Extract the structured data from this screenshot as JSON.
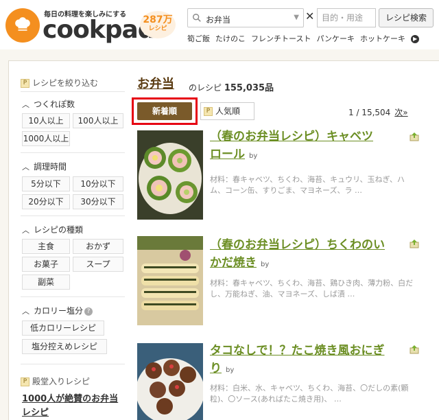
{
  "header": {
    "tagline": "毎日の料理を楽しみにする",
    "logo": "cookpad",
    "count_num": "287万",
    "count_unit": "レシピ",
    "search_value": "お弁当",
    "purpose_placeholder": "目的・用途",
    "search_button": "レシピ検索",
    "keywords": [
      "筍ご飯",
      "たけのこ",
      "フレンチトースト",
      "パンケーキ",
      "ホットケーキ"
    ]
  },
  "sidebar": {
    "filter_title": "レシピを絞り込む",
    "servings": {
      "title": "つくれぽ数",
      "chips": [
        "10人以上",
        "100人以上",
        "1000人以上"
      ]
    },
    "time": {
      "title": "調理時間",
      "chips": [
        "5分以下",
        "10分以下",
        "20分以下",
        "30分以下"
      ]
    },
    "kind": {
      "title": "レシピの種類",
      "chips": [
        "主食",
        "おかず",
        "お菓子",
        "スープ",
        "副菜"
      ]
    },
    "calorie": {
      "title": "カロリー塩分",
      "chips": [
        "低カロリーレシピ",
        "塩分控えめレシピ"
      ]
    },
    "hall": {
      "title": "殿堂入りレシピ",
      "link": "1000人が絶賛のお弁当レシピ"
    }
  },
  "main": {
    "title": "お弁当",
    "sub_prefix": "のレシピ",
    "count": "155,035品",
    "sort_new": "新着順",
    "sort_popular": "人気順",
    "pager": "1 / 15,504",
    "next": "次»",
    "recipes": [
      {
        "title_line1": "（春のお弁当レシピ）キャベツ",
        "title_line2": "ロール",
        "by": "by",
        "ingredients": "材料：春キャベツ、ちくわ、海苔、キュウリ、玉ねぎ、ハム、コーン缶、すりごま、マヨネーズ、ラ …"
      },
      {
        "title_line1": "（春のお弁当レシピ）ちくわのい",
        "title_line2": "かだ焼き",
        "by": "by",
        "ingredients": "材料：春キャベツ、ちくわ、海苔、鶏ひき肉、薄力粉、白だし、万能ねぎ、油、マヨネーズ、しば漬 …"
      },
      {
        "title_line1": "タコなしで！？たこ焼き風おにぎ",
        "title_line2": "り",
        "by": "by",
        "ingredients": "材料：白米、水、キャベツ、ちくわ、海苔、〇だしの素(顆粒)、〇ソース(あればたこ焼き用)、 …"
      }
    ]
  },
  "colors": {
    "accent": "#f48f1f",
    "recipe_title": "#6b8e23",
    "sort_active": "#7a5a2a",
    "highlight": "#e60012"
  }
}
